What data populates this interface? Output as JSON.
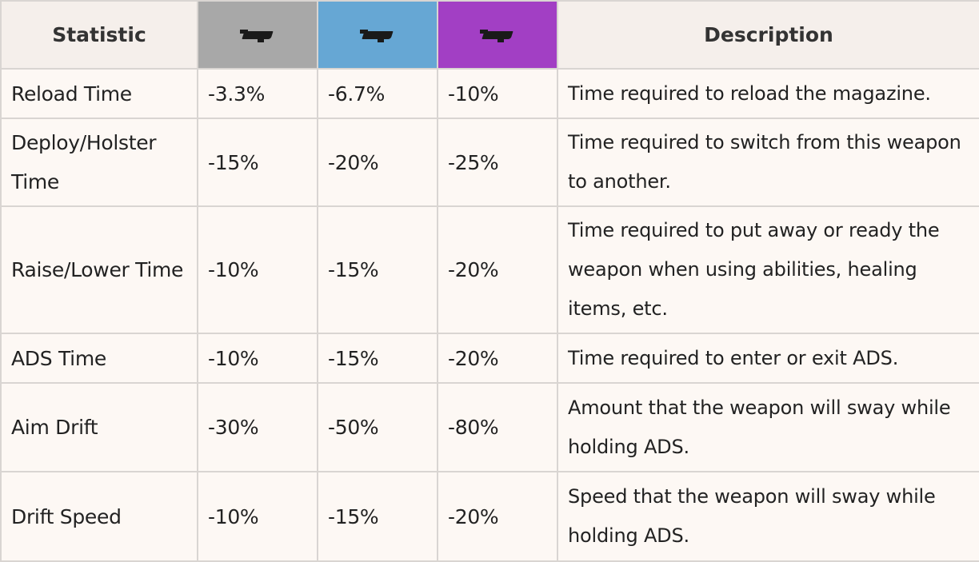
{
  "table": {
    "headers": {
      "statistic": "Statistic",
      "description": "Description"
    },
    "tiers": [
      {
        "icon": "weapon-silhouette-icon",
        "color": "#a8a8a8"
      },
      {
        "icon": "weapon-silhouette-icon",
        "color": "#66a7d4"
      },
      {
        "icon": "weapon-silhouette-icon",
        "color": "#a23fc4"
      }
    ],
    "rows": [
      {
        "statistic": "Reload Time",
        "tier1": "-3.3%",
        "tier2": "-6.7%",
        "tier3": "-10%",
        "description": "Time required to reload the magazine."
      },
      {
        "statistic": "Deploy/Holster Time",
        "tier1": "-15%",
        "tier2": "-20%",
        "tier3": "-25%",
        "description": "Time required to switch from this weapon to another."
      },
      {
        "statistic": "Raise/Lower Time",
        "tier1": "-10%",
        "tier2": "-15%",
        "tier3": "-20%",
        "description": "Time required to put away or ready the weapon when using abilities, healing items, etc."
      },
      {
        "statistic": "ADS Time",
        "tier1": "-10%",
        "tier2": "-15%",
        "tier3": "-20%",
        "description": "Time required to enter or exit ADS."
      },
      {
        "statistic": "Aim Drift",
        "tier1": "-30%",
        "tier2": "-50%",
        "tier3": "-80%",
        "description": "Amount that the weapon will sway while holding ADS."
      },
      {
        "statistic": "Drift Speed",
        "tier1": "-10%",
        "tier2": "-15%",
        "tier3": "-20%",
        "description": "Speed that the weapon will sway while holding ADS."
      }
    ]
  }
}
